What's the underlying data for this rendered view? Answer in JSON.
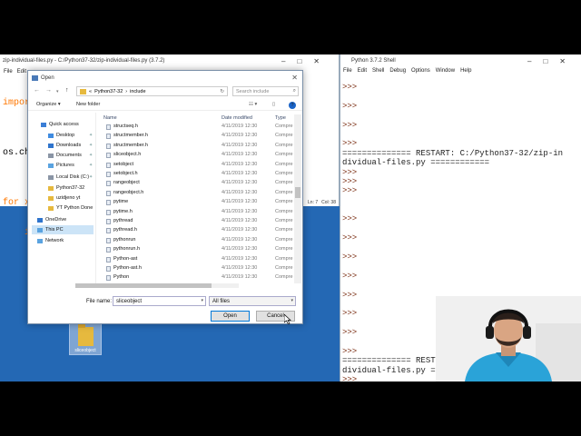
{
  "editor": {
    "title": "zip-individual-files.py - C:/Python37-32/zip-individual-files.py (3.7.2)",
    "menu": [
      "File",
      "Edit"
    ],
    "code_lines": [
      "impor",
      "",
      "os.ch",
      "",
      "for x",
      "    i"
    ],
    "status_ln": "Ln: 7",
    "status_col": "Col: 38"
  },
  "shell": {
    "title": "Python 3.7.2 Shell",
    "menu": [
      "File",
      "Edit",
      "Shell",
      "Debug",
      "Options",
      "Window",
      "Help"
    ],
    "lines": [
      {
        "t": ">>>",
        "k": "prompt"
      },
      {
        "t": "",
        "k": ""
      },
      {
        "t": ">>>",
        "k": "prompt"
      },
      {
        "t": "",
        "k": ""
      },
      {
        "t": ">>>",
        "k": "prompt"
      },
      {
        "t": "",
        "k": ""
      },
      {
        "t": ">>>",
        "k": "prompt"
      },
      {
        "t": "============== RESTART: C:/Python37-32/zip-in",
        "k": "restart"
      },
      {
        "t": "dividual-files.py ============",
        "k": "restart"
      },
      {
        "t": ">>>",
        "k": "prompt"
      },
      {
        "t": ">>>",
        "k": "prompt"
      },
      {
        "t": ">>>",
        "k": "prompt"
      },
      {
        "t": "",
        "k": ""
      },
      {
        "t": "",
        "k": ""
      },
      {
        "t": ">>>",
        "k": "prompt"
      },
      {
        "t": "",
        "k": ""
      },
      {
        "t": ">>>",
        "k": "prompt"
      },
      {
        "t": "",
        "k": ""
      },
      {
        "t": ">>>",
        "k": "prompt"
      },
      {
        "t": "",
        "k": ""
      },
      {
        "t": ">>>",
        "k": "prompt"
      },
      {
        "t": "",
        "k": ""
      },
      {
        "t": ">>>",
        "k": "prompt"
      },
      {
        "t": "",
        "k": ""
      },
      {
        "t": ">>>",
        "k": "prompt"
      },
      {
        "t": "",
        "k": ""
      },
      {
        "t": ">>>",
        "k": "prompt"
      },
      {
        "t": "",
        "k": ""
      },
      {
        "t": ">>>",
        "k": "prompt"
      },
      {
        "t": "============== REST",
        "k": "restart"
      },
      {
        "t": "dividual-files.py =",
        "k": "restart"
      },
      {
        "t": ">>>",
        "k": "prompt"
      }
    ]
  },
  "desktop_icon": {
    "label": "sliceobject"
  },
  "dialog": {
    "title": "Open",
    "address": {
      "prefix": "«",
      "crumb1": "Python37-32",
      "sep": "›",
      "crumb2": "include"
    },
    "search_placeholder": "Search include",
    "organize": "Organize ▾",
    "new_folder": "New folder",
    "help": "?",
    "nav_items": [
      {
        "label": "Quick access",
        "icon": "star-icon",
        "color": "#3b7ed6",
        "pinned": false
      },
      {
        "label": "Desktop",
        "icon": "folder-icon",
        "color": "#3f8be0",
        "pinned": true
      },
      {
        "label": "Downloads",
        "icon": "download-icon",
        "color": "#2f74cc",
        "pinned": true
      },
      {
        "label": "Documents",
        "icon": "document-icon",
        "color": "#8a95a5",
        "pinned": true
      },
      {
        "label": "Pictures",
        "icon": "picture-icon",
        "color": "#5aa3e0",
        "pinned": true
      },
      {
        "label": "Local Disk (C:)",
        "icon": "drive-icon",
        "color": "#8a95a5",
        "pinned": true
      },
      {
        "label": "Python37-32",
        "icon": "folder-icon",
        "color": "#e6b93e",
        "pinned": false
      },
      {
        "label": "uzidjeno yt",
        "icon": "folder-icon",
        "color": "#e6b93e",
        "pinned": false
      },
      {
        "label": "YT Python Done",
        "icon": "folder-icon",
        "color": "#e6b93e",
        "pinned": false
      },
      {
        "label": "OneDrive",
        "icon": "cloud-icon",
        "color": "#2f74cc",
        "pinned": false
      },
      {
        "label": "This PC",
        "icon": "computer-icon",
        "color": "#5aa3e0",
        "pinned": false
      },
      {
        "label": "Network",
        "icon": "network-icon",
        "color": "#5aa3e0",
        "pinned": false
      }
    ],
    "columns": {
      "name": "Name",
      "date": "Date modified",
      "type": "Type"
    },
    "files": [
      {
        "name": "structseq.h",
        "date": "4/11/2019 12:30",
        "type": "Compre"
      },
      {
        "name": "structmember.h",
        "date": "4/11/2019 12:30",
        "type": "Compre"
      },
      {
        "name": "structmember.h",
        "date": "4/11/2019 12:30",
        "type": "Compre"
      },
      {
        "name": "sliceobject.h",
        "date": "4/11/2019 12:30",
        "type": "Compre"
      },
      {
        "name": "setobject",
        "date": "4/11/2019 12:30",
        "type": "Compre"
      },
      {
        "name": "setobject.h",
        "date": "4/11/2019 12:30",
        "type": "Compre"
      },
      {
        "name": "rangeobject",
        "date": "4/11/2019 12:30",
        "type": "Compre"
      },
      {
        "name": "rangeobject.h",
        "date": "4/11/2019 12:30",
        "type": "Compre"
      },
      {
        "name": "pytime",
        "date": "4/11/2019 12:30",
        "type": "Compre"
      },
      {
        "name": "pytime.h",
        "date": "4/11/2019 12:30",
        "type": "Compre"
      },
      {
        "name": "pythread",
        "date": "4/11/2019 12:30",
        "type": "Compre"
      },
      {
        "name": "pythread.h",
        "date": "4/11/2019 12:30",
        "type": "Compre"
      },
      {
        "name": "pythonrun",
        "date": "4/11/2019 12:30",
        "type": "Compre"
      },
      {
        "name": "pythonrun.h",
        "date": "4/11/2019 12:30",
        "type": "Compre"
      },
      {
        "name": "Python-ast",
        "date": "4/11/2019 12:30",
        "type": "Compre"
      },
      {
        "name": "Python-ast.h",
        "date": "4/11/2019 12:30",
        "type": "Compre"
      },
      {
        "name": "Python",
        "date": "4/11/2019 12:30",
        "type": "Compre"
      }
    ],
    "file_name_label": "File name:",
    "file_name_value": "sliceobject",
    "file_type": "All files",
    "open_button": "Open",
    "cancel_button": "Cancel"
  }
}
